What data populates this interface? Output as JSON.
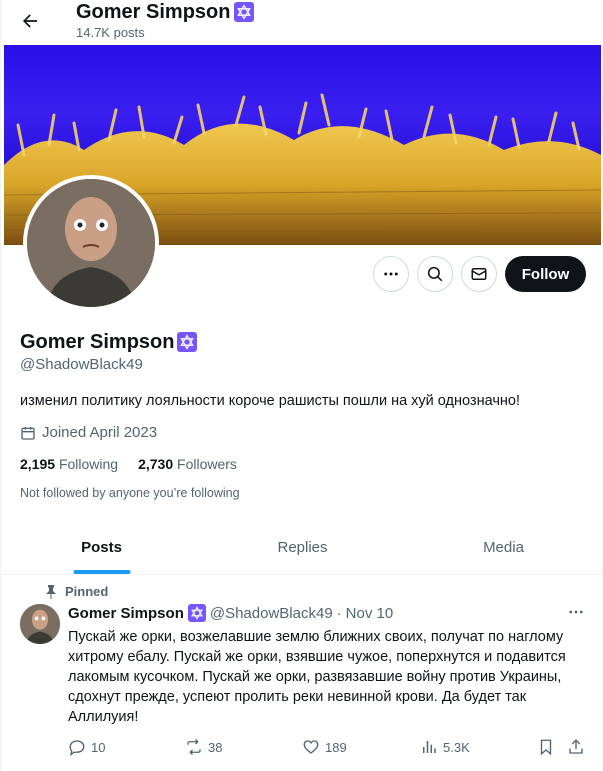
{
  "header": {
    "name": "Gomer Simpson",
    "posts_count": "14.7K posts"
  },
  "profile": {
    "name": "Gomer Simpson",
    "handle": "@ShadowBlack49",
    "bio": "изменил политику лояльности короче рашисты пошли на хуй однозначно!",
    "joined": "Joined April 2023",
    "following_count": "2,195",
    "following_label": "Following",
    "followers_count": "2,730",
    "followers_label": "Followers",
    "not_followed_note": "Not followed by anyone you’re following"
  },
  "actions": {
    "follow_label": "Follow"
  },
  "tabs": [
    {
      "label": "Posts",
      "active": true
    },
    {
      "label": "Replies",
      "active": false
    },
    {
      "label": "Media",
      "active": false
    }
  ],
  "pinned_tweet": {
    "pinned_label": "Pinned",
    "author_name": "Gomer Simpson",
    "author_handle": "@ShadowBlack49",
    "separator": "·",
    "date": "Nov 10",
    "text": "Пускай же орки, возжелавшие землю ближних своих, получат по наглому хитрому ебалу. Пускай же орки, взявшие чужое, поперхнутся и подавится лакомым кусочком. Пускай же орки, развязавшие войну против Украины, сдохнут прежде, успеют пролить реки невинной крови. Да будет так Аллилуия!",
    "replies": "10",
    "reposts": "38",
    "likes": "189",
    "views": "5.3K"
  },
  "icons": {
    "back": "arrow-left-icon",
    "badge": "star-of-david-icon",
    "more": "more-icon",
    "search": "search-icon",
    "message": "mail-icon",
    "calendar": "calendar-icon",
    "pin": "pin-icon",
    "reply": "reply-icon",
    "repost": "repost-icon",
    "like": "heart-icon",
    "views": "views-icon",
    "bookmark": "bookmark-icon",
    "share": "share-icon"
  },
  "colors": {
    "accent": "#1d9bf0",
    "badge": "#7856ff",
    "banner_sky": "#2a10e8",
    "banner_wheat": "#d9a528"
  }
}
